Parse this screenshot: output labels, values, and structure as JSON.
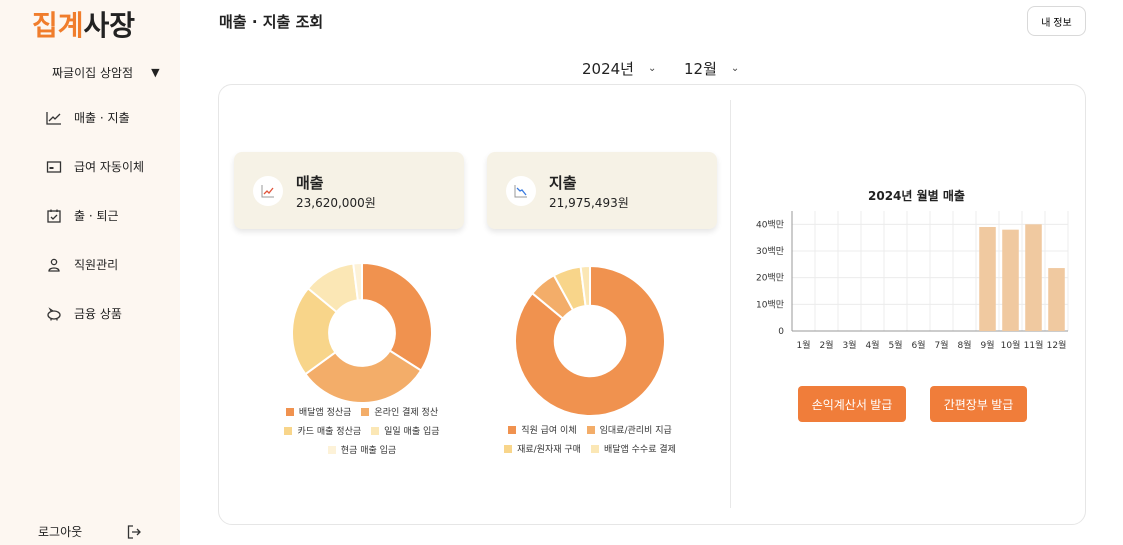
{
  "logo": {
    "part1": "집계",
    "part2": "사장"
  },
  "sidebar": {
    "store_name": "짜글이집 상암점",
    "items": [
      {
        "label": "매출 · 지출",
        "icon": "line-chart-icon"
      },
      {
        "label": "급여 자동이체",
        "icon": "card-icon"
      },
      {
        "label": "출 · 퇴근",
        "icon": "calendar-check-icon"
      },
      {
        "label": "직원관리",
        "icon": "person-icon"
      },
      {
        "label": "금융 상품",
        "icon": "piggy-bank-icon"
      }
    ],
    "logout_label": "로그아웃"
  },
  "header": {
    "title": "매출 · 지출 조회",
    "profile_label": "내 정보"
  },
  "period": {
    "year": "2024년",
    "month": "12월"
  },
  "summary": {
    "revenue": {
      "title": "매출",
      "amount": "23,620,000원"
    },
    "expense": {
      "title": "지출",
      "amount": "21,975,493원"
    }
  },
  "colors": {
    "accent": "#f07d3a",
    "card_bg": "#f6f2e6",
    "sidebar_bg": "#fdf7f1"
  },
  "revenue_breakdown": {
    "items": [
      {
        "label": "배달앱 정산금",
        "value": 34,
        "color": "#f0924f"
      },
      {
        "label": "온라인 결제 정산",
        "value": 31,
        "color": "#f3ad69"
      },
      {
        "label": "카드 매출 정산금",
        "value": 21,
        "color": "#f8d58a"
      },
      {
        "label": "일일 매출 입금",
        "value": 12,
        "color": "#fbe7b5"
      },
      {
        "label": "현금 매출 입금",
        "value": 2,
        "color": "#fdf2d8"
      }
    ]
  },
  "expense_breakdown": {
    "items": [
      {
        "label": "직원 급여 이체",
        "value": 86,
        "color": "#f0924f"
      },
      {
        "label": "임대료/관리비 지급",
        "value": 6,
        "color": "#f3ad69"
      },
      {
        "label": "재료/원자재 구매",
        "value": 6,
        "color": "#f8d58a"
      },
      {
        "label": "배달앱 수수료 결제",
        "value": 2,
        "color": "#fbe7b5"
      }
    ]
  },
  "chart_data": {
    "type": "bar",
    "title": "2024년 월별 매출",
    "categories": [
      "1월",
      "2월",
      "3월",
      "4월",
      "5월",
      "6월",
      "7월",
      "8월",
      "9월",
      "10월",
      "11월",
      "12월"
    ],
    "values": [
      0,
      0,
      0,
      0,
      0,
      0,
      0,
      0,
      39,
      38,
      40,
      23.6
    ],
    "ytick_labels": [
      "0",
      "10백만",
      "20백만",
      "30백만",
      "40백만"
    ],
    "ylim": [
      0,
      45
    ],
    "grid": true,
    "bar_color": "#f0c9a0"
  },
  "actions": {
    "pl_button": "손익계산서 발급",
    "ledger_button": "간편장부 발급"
  }
}
